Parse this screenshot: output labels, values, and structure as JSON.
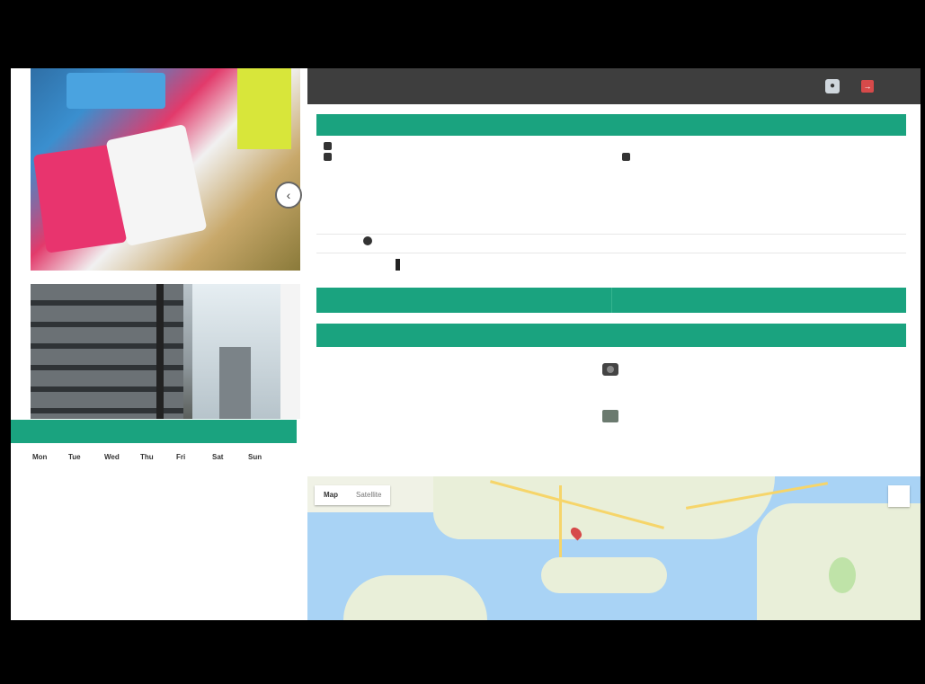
{
  "left_panel": {
    "photo_1_alt": "",
    "photo_2_alt": "",
    "caption": "",
    "thumbnails": [
      "",
      "",
      "",
      "",
      ""
    ],
    "days": [
      "Mon",
      "Tue",
      "Wed",
      "Thu",
      "Fri",
      "Sat",
      "Sun"
    ]
  },
  "topbar": {
    "link_1": "",
    "link_2": ""
  },
  "inspection": {
    "header": "",
    "col_a": {
      "row_1_label": "",
      "row_1_value": "",
      "row_2_label": "",
      "row_3_label": "",
      "row_3_value": "",
      "row_4_label": "",
      "row_4_value": "",
      "row_5_value": ""
    },
    "col_b": {
      "row_1_label": "",
      "row_1_value": "",
      "row_2_label": "",
      "row_2_value": "",
      "row_3_label": "",
      "row_3_value": "",
      "row_4_label": "",
      "row_5_label": ""
    },
    "tags_label": "",
    "signature": "",
    "actions": [
      "",
      ""
    ],
    "photos_section": ""
  },
  "map": {
    "type_options": [
      "Map",
      "Satellite"
    ],
    "place_label": ""
  },
  "icons": {
    "nav": "chevron-left-icon",
    "user": "user-icon",
    "logout": "logout-icon",
    "camera": "camera-icon",
    "folder": "folder-icon"
  },
  "colors": {
    "accent": "#1aa37f",
    "topbar": "#3e3e3e",
    "logout": "#d64a4a"
  }
}
